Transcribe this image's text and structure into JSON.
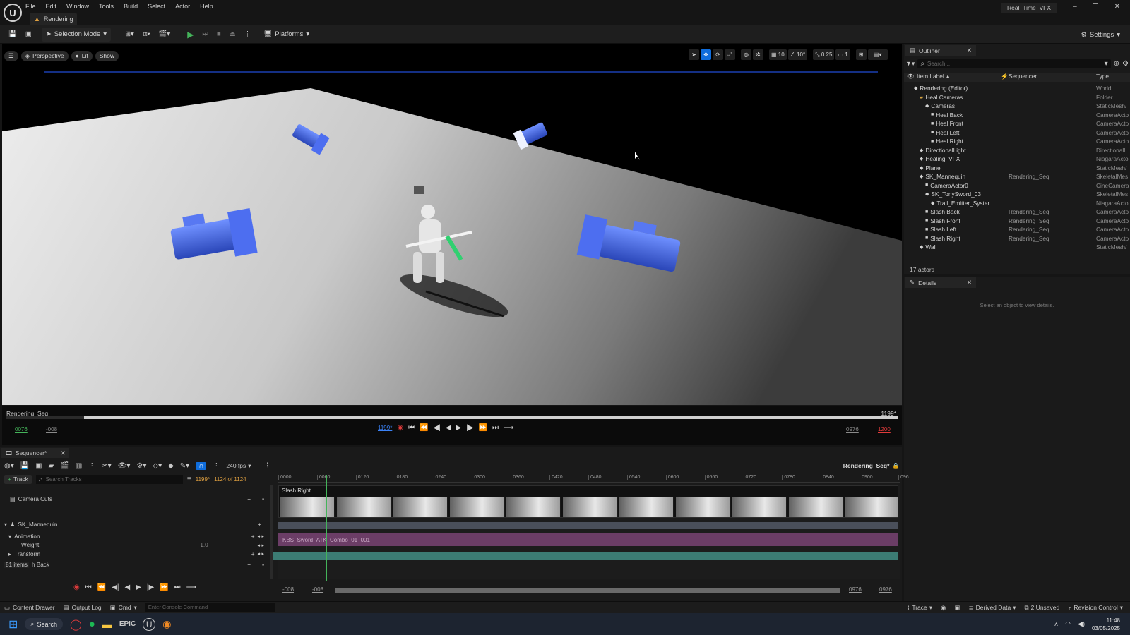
{
  "app": {
    "menu": [
      "File",
      "Edit",
      "Window",
      "Tools",
      "Build",
      "Select",
      "Actor",
      "Help"
    ],
    "level_tab": "Rendering",
    "project_name": "Real_Time_VFX"
  },
  "toolbar": {
    "selection_mode": "Selection Mode",
    "platforms": "Platforms",
    "settings": "Settings"
  },
  "viewport": {
    "perspective": "Perspective",
    "lit": "Lit",
    "show": "Show",
    "grid_snap": "10",
    "rot_snap": "10°",
    "scale_snap": "0.25",
    "camera_speed": "1"
  },
  "playback": {
    "sequence_name": "Rendering_Seq",
    "frame_right": "1199*",
    "start_green": "0076",
    "start_gray": "-008",
    "current_frame": "1199*",
    "end_gray": "0976",
    "end_red": "1200"
  },
  "outliner": {
    "tab_title": "Outliner",
    "search_placeholder": "Search...",
    "col_label": "Item Label",
    "col_seq": "Sequencer",
    "col_type": "Type",
    "rows": [
      {
        "label": "Rendering (Editor)",
        "seq": "",
        "type": "World",
        "depth": 0
      },
      {
        "label": "Heal Cameras",
        "seq": "",
        "type": "Folder",
        "depth": 1
      },
      {
        "label": "Cameras",
        "seq": "",
        "type": "StaticMesh/",
        "depth": 2
      },
      {
        "label": "Heal Back",
        "seq": "",
        "type": "CameraActo",
        "depth": 3
      },
      {
        "label": "Heal Front",
        "seq": "",
        "type": "CameraActo",
        "depth": 3
      },
      {
        "label": "Heal Left",
        "seq": "",
        "type": "CameraActo",
        "depth": 3
      },
      {
        "label": "Heal Right",
        "seq": "",
        "type": "CameraActo",
        "depth": 3
      },
      {
        "label": "DirectionalLight",
        "seq": "",
        "type": "DirectionalL",
        "depth": 1
      },
      {
        "label": "Healing_VFX",
        "seq": "",
        "type": "NiagaraActo",
        "depth": 1
      },
      {
        "label": "Plane",
        "seq": "",
        "type": "StaticMesh/",
        "depth": 1
      },
      {
        "label": "SK_Mannequin",
        "seq": "Rendering_Seq",
        "type": "SkeletalMes",
        "depth": 1
      },
      {
        "label": "CameraActor0",
        "seq": "",
        "type": "CineCamera",
        "depth": 2
      },
      {
        "label": "SK_TonySword_03",
        "seq": "",
        "type": "SkeletalMes",
        "depth": 2
      },
      {
        "label": "Trail_Emitter_Syster",
        "seq": "",
        "type": "NiagaraActo",
        "depth": 3
      },
      {
        "label": "Slash Back",
        "seq": "Rendering_Seq",
        "type": "CameraActo",
        "depth": 2
      },
      {
        "label": "Slash Front",
        "seq": "Rendering_Seq",
        "type": "CameraActo",
        "depth": 2
      },
      {
        "label": "Slash Left",
        "seq": "Rendering_Seq",
        "type": "CameraActo",
        "depth": 2
      },
      {
        "label": "Slash Right",
        "seq": "Rendering_Seq",
        "type": "CameraActo",
        "depth": 2
      },
      {
        "label": "Wall",
        "seq": "",
        "type": "StaticMesh/",
        "depth": 1
      }
    ],
    "actor_count": "17 actors"
  },
  "details": {
    "tab_title": "Details",
    "empty_text": "Select an object to view details."
  },
  "sequencer": {
    "tab_title": "Sequencer*",
    "fps": "240 fps",
    "seq_name": "Rendering_Seq*",
    "add_track": "Track",
    "search_placeholder": "Search Tracks",
    "current_frame": "1199*",
    "frame_count": "1124 of 1124",
    "ruler": [
      "0000",
      "0060",
      "0120",
      "0180",
      "0240",
      "0300",
      "0360",
      "0420",
      "0480",
      "0540",
      "0600",
      "0660",
      "0720",
      "0780",
      "0840",
      "0900",
      "096"
    ],
    "tracks": {
      "camera_cuts": "Camera Cuts",
      "mannequin": "SK_Mannequin",
      "animation": "Animation",
      "weight": "Weight",
      "weight_value": "1.0",
      "transform": "Transform",
      "partial": "h Back"
    },
    "items_count": "81 items",
    "shot_label": "Slash Right",
    "anim_clip": "KBS_Sword_ATK_Combo_01_001",
    "view_start": "-008",
    "view_start2": "-008",
    "view_end": "0976",
    "view_end2": "0976"
  },
  "statusbar": {
    "content_drawer": "Content Drawer",
    "output_log": "Output Log",
    "cmd": "Cmd",
    "console_placeholder": "Enter Console Command",
    "trace": "Trace",
    "derived_data": "Derived Data",
    "unsaved": "2 Unsaved",
    "revision_control": "Revision Control"
  },
  "taskbar": {
    "search": "Search",
    "time": "11:48",
    "date": "03/05/2025"
  },
  "colors": {
    "accent_blue": "#0f6ddc",
    "green": "#44b35a",
    "red": "#e03b3b",
    "camera_blue": "#3a5fd0",
    "anim_purple": "#6b3d66",
    "transform_teal": "#3c7c74"
  }
}
